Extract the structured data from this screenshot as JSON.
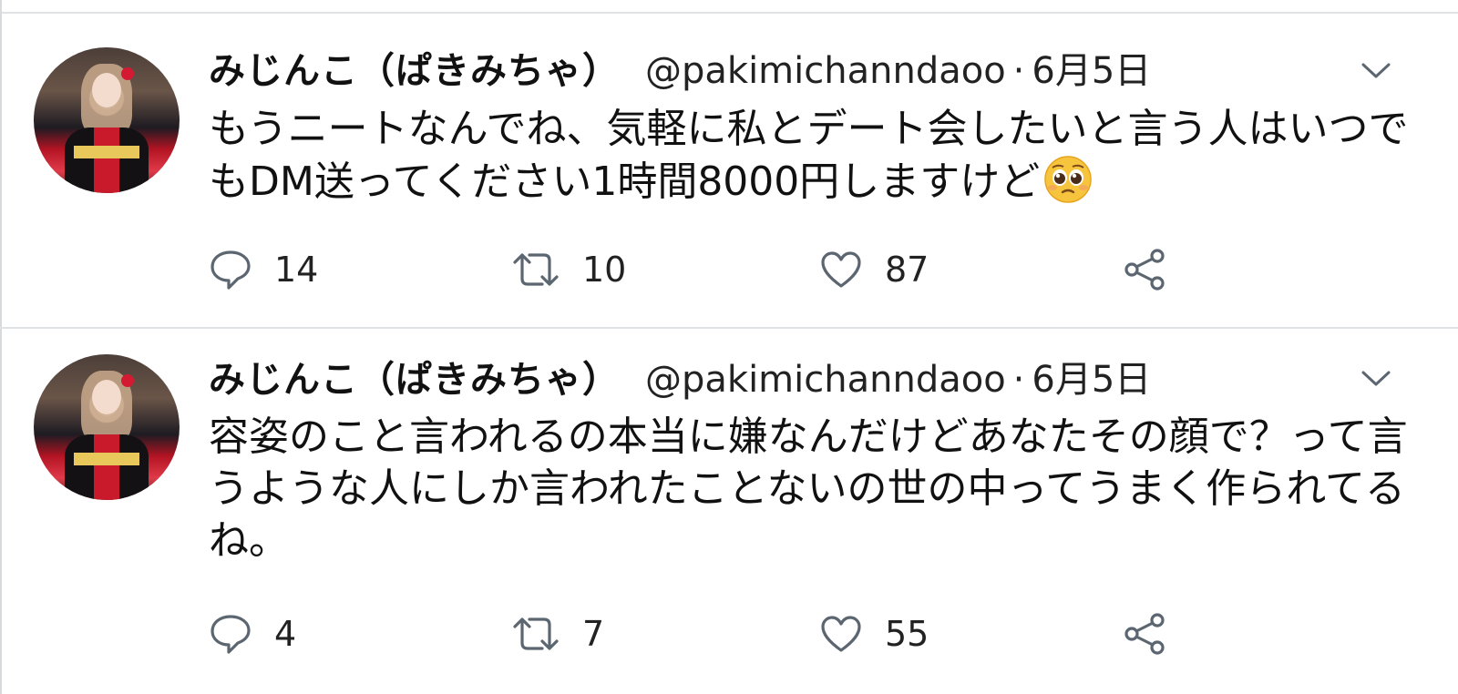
{
  "tweets": [
    {
      "name": "みじんこ（ぱきみちゃ）",
      "handle": "@pakimichanndaoo",
      "separator": "·",
      "date": "6月5日",
      "text": "もうニートなんでね、気軽に私とデート会したいと言う人はいつでもDM送ってください1時間8000円しますけど",
      "emoji": "pleading-face",
      "replies": "14",
      "retweets": "10",
      "likes": "87"
    },
    {
      "name": "みじんこ（ぱきみちゃ）",
      "handle": "@pakimichanndaoo",
      "separator": "·",
      "date": "6月5日",
      "text": "容姿のこと言われるの本当に嫌なんだけどあなたその顔で？って言うような人にしか言われたことないの世の中ってうまく作られてるね。",
      "replies": "4",
      "retweets": "7",
      "likes": "55"
    }
  ],
  "icons": {
    "reply": "reply-icon",
    "retweet": "retweet-icon",
    "like": "heart-icon",
    "share": "share-icon",
    "menu": "chevron-down-icon"
  },
  "colors": {
    "text": "#111111",
    "icon": "#5b6670",
    "divider": "#dfe3e6"
  }
}
